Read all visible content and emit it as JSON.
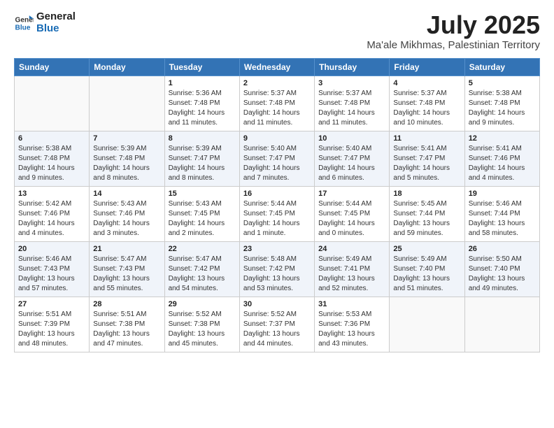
{
  "header": {
    "logo_line1": "General",
    "logo_line2": "Blue",
    "title": "July 2025",
    "subtitle": "Ma'ale Mikhmas, Palestinian Territory"
  },
  "weekdays": [
    "Sunday",
    "Monday",
    "Tuesday",
    "Wednesday",
    "Thursday",
    "Friday",
    "Saturday"
  ],
  "weeks": [
    [
      {
        "day": "",
        "sunrise": "",
        "sunset": "",
        "daylight": ""
      },
      {
        "day": "",
        "sunrise": "",
        "sunset": "",
        "daylight": ""
      },
      {
        "day": "1",
        "sunrise": "Sunrise: 5:36 AM",
        "sunset": "Sunset: 7:48 PM",
        "daylight": "Daylight: 14 hours and 11 minutes."
      },
      {
        "day": "2",
        "sunrise": "Sunrise: 5:37 AM",
        "sunset": "Sunset: 7:48 PM",
        "daylight": "Daylight: 14 hours and 11 minutes."
      },
      {
        "day": "3",
        "sunrise": "Sunrise: 5:37 AM",
        "sunset": "Sunset: 7:48 PM",
        "daylight": "Daylight: 14 hours and 11 minutes."
      },
      {
        "day": "4",
        "sunrise": "Sunrise: 5:37 AM",
        "sunset": "Sunset: 7:48 PM",
        "daylight": "Daylight: 14 hours and 10 minutes."
      },
      {
        "day": "5",
        "sunrise": "Sunrise: 5:38 AM",
        "sunset": "Sunset: 7:48 PM",
        "daylight": "Daylight: 14 hours and 9 minutes."
      }
    ],
    [
      {
        "day": "6",
        "sunrise": "Sunrise: 5:38 AM",
        "sunset": "Sunset: 7:48 PM",
        "daylight": "Daylight: 14 hours and 9 minutes."
      },
      {
        "day": "7",
        "sunrise": "Sunrise: 5:39 AM",
        "sunset": "Sunset: 7:48 PM",
        "daylight": "Daylight: 14 hours and 8 minutes."
      },
      {
        "day": "8",
        "sunrise": "Sunrise: 5:39 AM",
        "sunset": "Sunset: 7:47 PM",
        "daylight": "Daylight: 14 hours and 8 minutes."
      },
      {
        "day": "9",
        "sunrise": "Sunrise: 5:40 AM",
        "sunset": "Sunset: 7:47 PM",
        "daylight": "Daylight: 14 hours and 7 minutes."
      },
      {
        "day": "10",
        "sunrise": "Sunrise: 5:40 AM",
        "sunset": "Sunset: 7:47 PM",
        "daylight": "Daylight: 14 hours and 6 minutes."
      },
      {
        "day": "11",
        "sunrise": "Sunrise: 5:41 AM",
        "sunset": "Sunset: 7:47 PM",
        "daylight": "Daylight: 14 hours and 5 minutes."
      },
      {
        "day": "12",
        "sunrise": "Sunrise: 5:41 AM",
        "sunset": "Sunset: 7:46 PM",
        "daylight": "Daylight: 14 hours and 4 minutes."
      }
    ],
    [
      {
        "day": "13",
        "sunrise": "Sunrise: 5:42 AM",
        "sunset": "Sunset: 7:46 PM",
        "daylight": "Daylight: 14 hours and 4 minutes."
      },
      {
        "day": "14",
        "sunrise": "Sunrise: 5:43 AM",
        "sunset": "Sunset: 7:46 PM",
        "daylight": "Daylight: 14 hours and 3 minutes."
      },
      {
        "day": "15",
        "sunrise": "Sunrise: 5:43 AM",
        "sunset": "Sunset: 7:45 PM",
        "daylight": "Daylight: 14 hours and 2 minutes."
      },
      {
        "day": "16",
        "sunrise": "Sunrise: 5:44 AM",
        "sunset": "Sunset: 7:45 PM",
        "daylight": "Daylight: 14 hours and 1 minute."
      },
      {
        "day": "17",
        "sunrise": "Sunrise: 5:44 AM",
        "sunset": "Sunset: 7:45 PM",
        "daylight": "Daylight: 14 hours and 0 minutes."
      },
      {
        "day": "18",
        "sunrise": "Sunrise: 5:45 AM",
        "sunset": "Sunset: 7:44 PM",
        "daylight": "Daylight: 13 hours and 59 minutes."
      },
      {
        "day": "19",
        "sunrise": "Sunrise: 5:46 AM",
        "sunset": "Sunset: 7:44 PM",
        "daylight": "Daylight: 13 hours and 58 minutes."
      }
    ],
    [
      {
        "day": "20",
        "sunrise": "Sunrise: 5:46 AM",
        "sunset": "Sunset: 7:43 PM",
        "daylight": "Daylight: 13 hours and 57 minutes."
      },
      {
        "day": "21",
        "sunrise": "Sunrise: 5:47 AM",
        "sunset": "Sunset: 7:43 PM",
        "daylight": "Daylight: 13 hours and 55 minutes."
      },
      {
        "day": "22",
        "sunrise": "Sunrise: 5:47 AM",
        "sunset": "Sunset: 7:42 PM",
        "daylight": "Daylight: 13 hours and 54 minutes."
      },
      {
        "day": "23",
        "sunrise": "Sunrise: 5:48 AM",
        "sunset": "Sunset: 7:42 PM",
        "daylight": "Daylight: 13 hours and 53 minutes."
      },
      {
        "day": "24",
        "sunrise": "Sunrise: 5:49 AM",
        "sunset": "Sunset: 7:41 PM",
        "daylight": "Daylight: 13 hours and 52 minutes."
      },
      {
        "day": "25",
        "sunrise": "Sunrise: 5:49 AM",
        "sunset": "Sunset: 7:40 PM",
        "daylight": "Daylight: 13 hours and 51 minutes."
      },
      {
        "day": "26",
        "sunrise": "Sunrise: 5:50 AM",
        "sunset": "Sunset: 7:40 PM",
        "daylight": "Daylight: 13 hours and 49 minutes."
      }
    ],
    [
      {
        "day": "27",
        "sunrise": "Sunrise: 5:51 AM",
        "sunset": "Sunset: 7:39 PM",
        "daylight": "Daylight: 13 hours and 48 minutes."
      },
      {
        "day": "28",
        "sunrise": "Sunrise: 5:51 AM",
        "sunset": "Sunset: 7:38 PM",
        "daylight": "Daylight: 13 hours and 47 minutes."
      },
      {
        "day": "29",
        "sunrise": "Sunrise: 5:52 AM",
        "sunset": "Sunset: 7:38 PM",
        "daylight": "Daylight: 13 hours and 45 minutes."
      },
      {
        "day": "30",
        "sunrise": "Sunrise: 5:52 AM",
        "sunset": "Sunset: 7:37 PM",
        "daylight": "Daylight: 13 hours and 44 minutes."
      },
      {
        "day": "31",
        "sunrise": "Sunrise: 5:53 AM",
        "sunset": "Sunset: 7:36 PM",
        "daylight": "Daylight: 13 hours and 43 minutes."
      },
      {
        "day": "",
        "sunrise": "",
        "sunset": "",
        "daylight": ""
      },
      {
        "day": "",
        "sunrise": "",
        "sunset": "",
        "daylight": ""
      }
    ]
  ]
}
